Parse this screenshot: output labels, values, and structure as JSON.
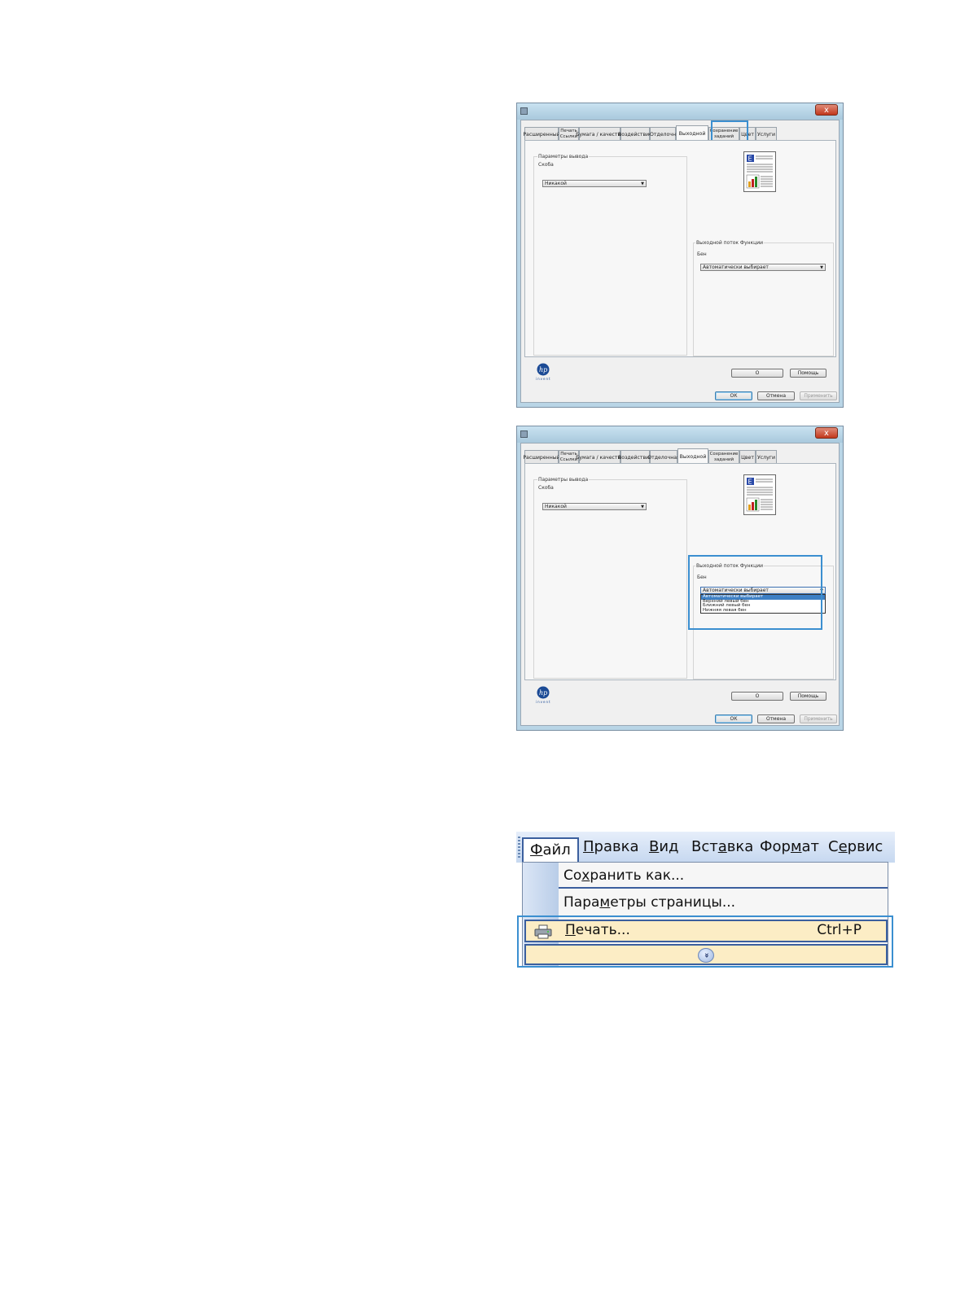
{
  "dialog": {
    "close_label": "x",
    "tabs": [
      {
        "label": "Расширенный"
      },
      {
        "label": "Печать\nСсылки"
      },
      {
        "label": "Бумага / качество"
      },
      {
        "label": "Воздействие"
      },
      {
        "label": "Отделочн"
      },
      {
        "label": "Выходной"
      },
      {
        "label": "Сохранение\nзаданий"
      },
      {
        "label": "Цвет"
      },
      {
        "label": "Услуги"
      }
    ],
    "tabs_second": [
      {
        "label": "Расширенный"
      },
      {
        "label": "Печать\nСсылки"
      },
      {
        "label": "Бумага / качество"
      },
      {
        "label": "Воздействие"
      },
      {
        "label": "Отделочная"
      },
      {
        "label": "Выходной"
      },
      {
        "label": "Сохранение\nзаданий"
      },
      {
        "label": "Цвет"
      },
      {
        "label": "Услуги"
      }
    ],
    "active_tab": "Выходной",
    "output_group_title": "Параметры вывода",
    "staple_label": "Скоба",
    "staple_value": "Никакой",
    "stream_group_title": "Выходной поток Функции",
    "bin_label": "Бен",
    "bin_value": "Автоматически выбирает",
    "bin_options": [
      "Автоматически выбирает",
      "Верхний левый бен",
      "Ближний левый бен",
      "Нижняя левая бен"
    ],
    "logo_text": "invent",
    "about_button": "О",
    "help_button": "Помощь",
    "ok_button": "ОК",
    "cancel_button": "Отмена",
    "apply_button": "Применить"
  },
  "menu": {
    "file": "Файл",
    "file_u": "Ф",
    "file_rest": "айл",
    "edit_u": "П",
    "edit_rest": "равка",
    "view_u": "В",
    "view_rest": "ид",
    "insert_pre": "Вст",
    "insert_u": "а",
    "insert_post": "вка",
    "format_pre": "Фор",
    "format_u": "м",
    "format_post": "ат",
    "tools_pre": "С",
    "tools_u": "е",
    "tools_post": "рвис",
    "save_as_pre": "Со",
    "save_as_u": "х",
    "save_as_post": "ранить как...",
    "page_setup_pre": "Пара",
    "page_setup_u": "м",
    "page_setup_post": "етры страницы...",
    "print_u": "П",
    "print_rest": "ечать...",
    "print_shortcut": "Ctrl+P",
    "expand_glyph": "»"
  },
  "colors": {
    "highlight": "#3b8fd0",
    "menu_hover": "#fcedc5",
    "menu_border": "#3b5f9e"
  }
}
